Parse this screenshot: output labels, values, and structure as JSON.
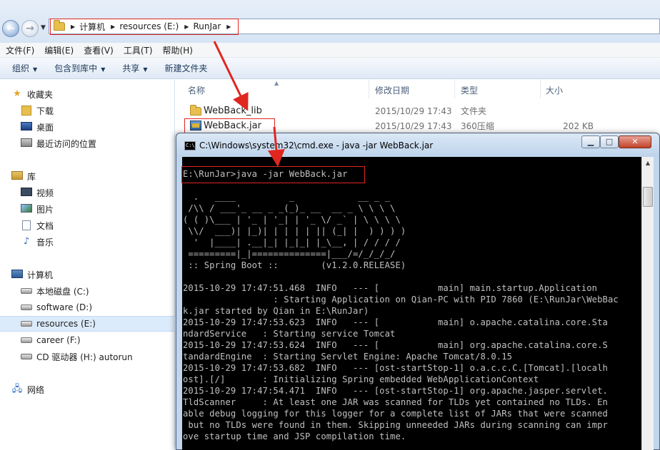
{
  "address": {
    "crumbs": [
      "计算机",
      "resources (E:)",
      "RunJar"
    ]
  },
  "menu": [
    "文件(F)",
    "编辑(E)",
    "查看(V)",
    "工具(T)",
    "帮助(H)"
  ],
  "commands": [
    {
      "label": "组织",
      "dropdown": true
    },
    {
      "label": "包含到库中",
      "dropdown": true
    },
    {
      "label": "共享",
      "dropdown": true
    },
    {
      "label": "新建文件夹",
      "dropdown": false
    }
  ],
  "sidebar": {
    "favorites": "收藏夹",
    "favorite_items": [
      "下载",
      "桌面",
      "最近访问的位置"
    ],
    "libraries": "库",
    "library_items": [
      "视频",
      "图片",
      "文档",
      "音乐"
    ],
    "computer": "计算机",
    "drives": [
      "本地磁盘 (C:)",
      "software (D:)",
      "resources (E:)",
      "career (F:)",
      "CD 驱动器 (H:) autorun"
    ],
    "network": "网络"
  },
  "columns": {
    "name": "名称",
    "date": "修改日期",
    "type": "类型",
    "size": "大小"
  },
  "files": [
    {
      "name": "WebBack_lib",
      "date": "2015/10/29 17:43",
      "type": "文件夹",
      "size": ""
    },
    {
      "name": "WebBack.jar",
      "date": "2015/10/29 17:43",
      "type": "360压缩",
      "size": "202 KB"
    }
  ],
  "cmd": {
    "title": "C:\\Windows\\system32\\cmd.exe - java  -jar WebBack.jar",
    "icon_text": "C:\\",
    "buttons": {
      "min": "▁",
      "max": "□",
      "close": "✕"
    },
    "output": "E:\\RunJar>java -jar WebBack.jar\n\n  .   ____          _            __ _ _\n /\\\\ / ___'_ __ _ _(_)_ __  __ _ \\ \\ \\ \\\n( ( )\\___ | '_ | '_| | '_ \\/ _` | \\ \\ \\ \\\n \\\\/  ___)| |_)| | | | | || (_| |  ) ) ) )\n  '  |____| .__|_| |_|_| |_\\__, | / / / /\n =========|_|==============|___/=/_/_/_/\n :: Spring Boot ::        (v1.2.0.RELEASE)\n\n2015-10-29 17:47:51.468  INFO   --- [           main] main.startup.Application\n                 : Starting Application on Qian-PC with PID 7860 (E:\\RunJar\\WebBac\nk.jar started by Qian in E:\\RunJar)\n2015-10-29 17:47:53.623  INFO   --- [           main] o.apache.catalina.core.Sta\nndardService   : Starting service Tomcat\n2015-10-29 17:47:53.624  INFO   --- [           main] org.apache.catalina.core.S\ntandardEngine  : Starting Servlet Engine: Apache Tomcat/8.0.15\n2015-10-29 17:47:53.682  INFO   --- [ost-startStop-1] o.a.c.c.C.[Tomcat].[localh\nost].[/]       : Initializing Spring embedded WebApplicationContext\n2015-10-29 17:47:54.471  INFO   --- [ost-startStop-1] org.apache.jasper.servlet.\nTldScanner     : At least one JAR was scanned for TLDs yet contained no TLDs. En\nable debug logging for this logger for a complete list of JARs that were scanned\n but no TLDs were found in them. Skipping unneeded JARs during scanning can impr\nove startup time and JSP compilation time."
  },
  "colors": {
    "annotation_red": "#e0261f",
    "selection": "#dcebfc",
    "console_bg": "#000000",
    "console_text": "#c0c0c0"
  }
}
